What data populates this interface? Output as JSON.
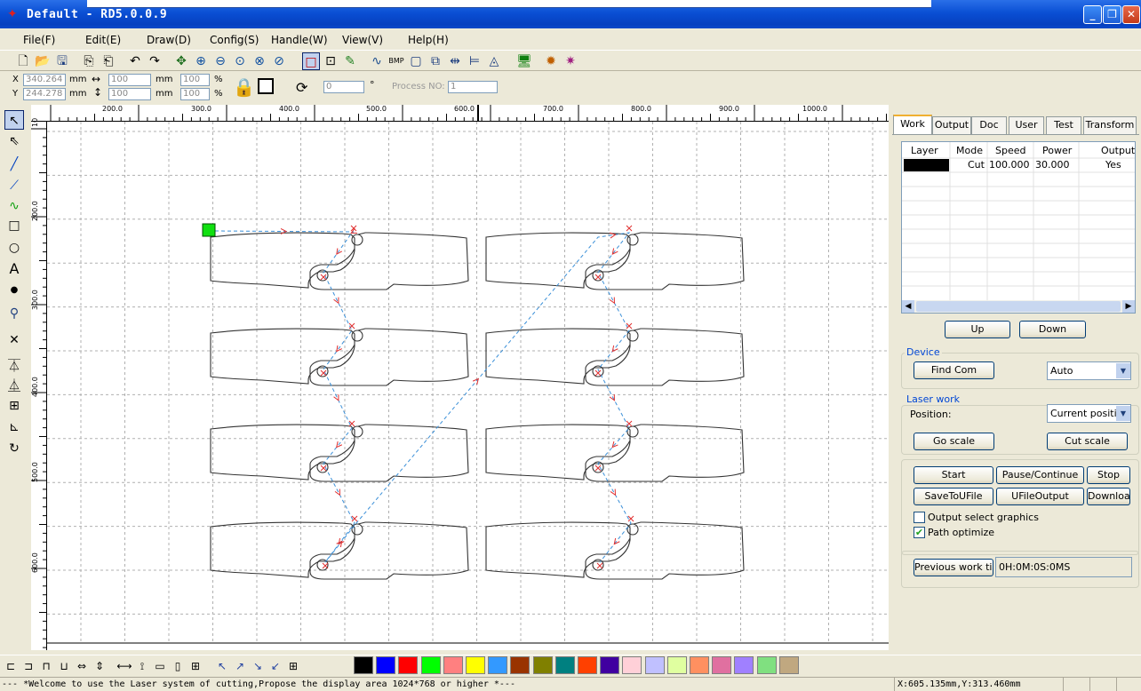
{
  "window": {
    "title": "Default - RD5.0.0.9",
    "app_icon": "rd-laser-icon"
  },
  "menu": [
    "File(F)",
    "Edit(E)",
    "Draw(D)",
    "Config(S)",
    "Handle(W)",
    "View(V)",
    "Help(H)"
  ],
  "toolbar2": {
    "x_label": "X",
    "y_label": "Y",
    "x_value": "340.264",
    "y_value": "244.278",
    "unit_mm": "mm",
    "width_value": "100",
    "height_value": "100",
    "pct_w": "100",
    "pct_h": "100",
    "pct": "%",
    "rotate_value": "0",
    "deg": "°",
    "process_label": "Process NO:",
    "process_value": "1"
  },
  "ruler_top": [
    "200.0",
    "300.0",
    "400.0",
    "500.0",
    "600.0",
    "700.0",
    "800.0",
    "900.0",
    "1000.0"
  ],
  "ruler_left": [
    "10",
    "200.0",
    "300.0",
    "400.0",
    "500.0",
    "600.0"
  ],
  "tabs": [
    "Work",
    "Output",
    "Doc",
    "User",
    "Test",
    "Transform"
  ],
  "layer_table": {
    "headers": [
      "Layer",
      "Mode",
      "Speed",
      "Power",
      "Output"
    ],
    "rows": [
      {
        "color": "#000000",
        "mode": "Cut",
        "speed": "100.000",
        "power": "30.000",
        "output": "Yes"
      }
    ]
  },
  "buttons": {
    "up": "Up",
    "down": "Down",
    "find_com": "Find Com",
    "go_scale": "Go scale",
    "cut_scale": "Cut scale",
    "start": "Start",
    "pause": "Pause/Continue",
    "stop": "Stop",
    "save_u": "SaveToUFile",
    "ufile_out": "UFileOutput",
    "download": "Download",
    "prev_time": "Previous work time"
  },
  "device": {
    "label": "Device",
    "com_select": "Auto"
  },
  "laser_work": {
    "label": "Laser work",
    "position_label": "Position:",
    "position_select": "Current position"
  },
  "checkboxes": {
    "output_select": "Output select graphics",
    "output_select_checked": false,
    "path_optimize": "Path optimize",
    "path_optimize_checked": true
  },
  "prev_time_value": "0H:0M:0S:0MS",
  "palette": [
    "#000000",
    "#0000ff",
    "#ff0000",
    "#00ff00",
    "#ff8080",
    "#ffff00",
    "#3399ff",
    "#993300",
    "#808000",
    "#008080",
    "#ff4000",
    "#4000a0",
    "#ffd0d8",
    "#c0c0ff",
    "#e0ffa0",
    "#ff9060",
    "#e070a0",
    "#a080ff",
    "#80e080",
    "#c0a880"
  ],
  "status": {
    "message": "--- *Welcome to use the Laser system of cutting,Propose the display area 1024*768 or higher *---",
    "coords": "X:605.135mm,Y:313.460mm"
  }
}
